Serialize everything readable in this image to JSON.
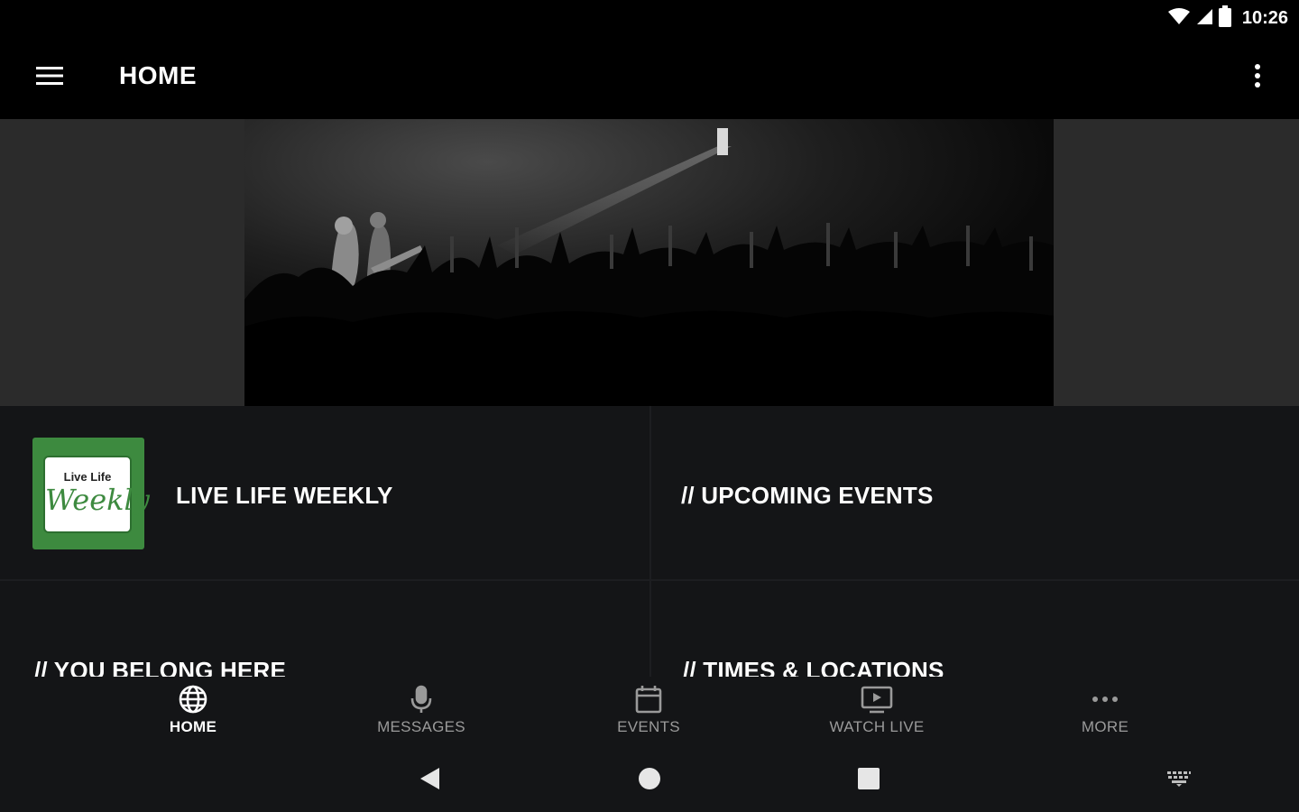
{
  "status_bar": {
    "time": "10:26",
    "icons": [
      "wifi-icon",
      "cell-signal-icon",
      "battery-icon"
    ]
  },
  "app_bar": {
    "title": "HOME",
    "menu_icon": "hamburger-menu-icon",
    "overflow_icon": "more-vert-icon"
  },
  "hero": {
    "image": "concert-crowd-photo"
  },
  "tiles": [
    {
      "title": "LIVE LIFE WEEKLY",
      "logo_small_text": "Live Life",
      "logo_script_text": "Weekly"
    },
    {
      "title": "// UPCOMING EVENTS"
    },
    {
      "title": "// YOU BELONG HERE"
    },
    {
      "title": "// TIMES & LOCATIONS"
    }
  ],
  "bottom_nav": {
    "items": [
      {
        "label": "HOME",
        "icon": "globe-icon",
        "active": true
      },
      {
        "label": "MESSAGES",
        "icon": "microphone-icon",
        "active": false
      },
      {
        "label": "EVENTS",
        "icon": "calendar-icon",
        "active": false
      },
      {
        "label": "WATCH LIVE",
        "icon": "tv-play-icon",
        "active": false
      },
      {
        "label": "MORE",
        "icon": "more-horiz-icon",
        "active": false
      }
    ]
  },
  "system_nav": {
    "buttons": [
      "back-icon",
      "home-circle-icon",
      "recents-square-icon",
      "keyboard-icon"
    ]
  },
  "colors": {
    "background": "#000000",
    "tile_background": "#141517",
    "hero_side": "#2b2b2b",
    "brand_green": "#3d8a3f",
    "inactive_label": "#9a9a9a"
  }
}
